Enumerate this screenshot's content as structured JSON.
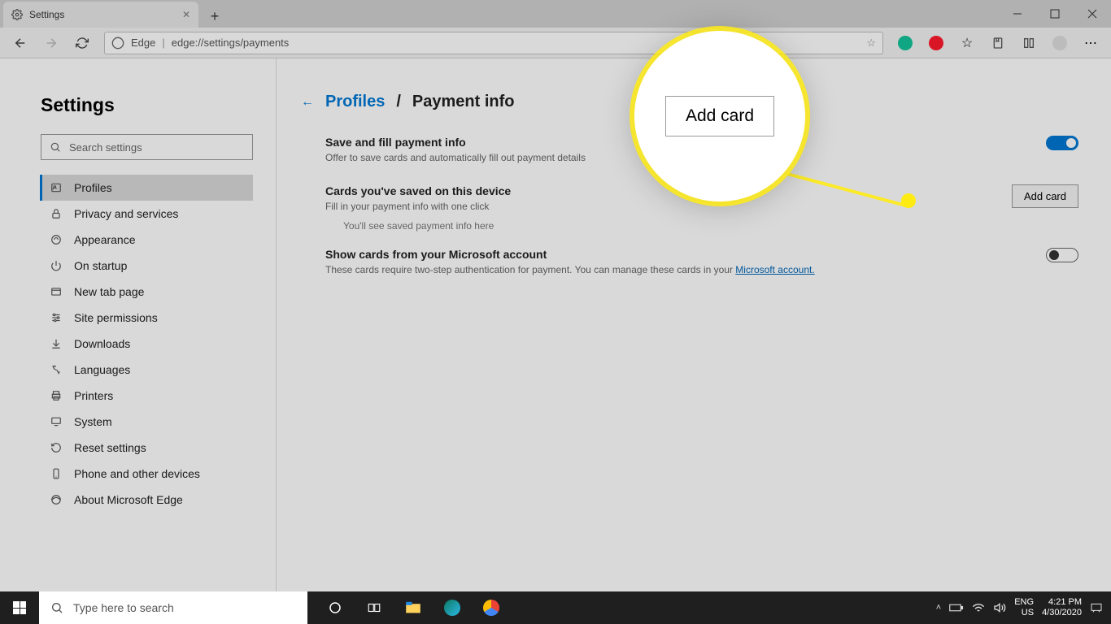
{
  "tab": {
    "title": "Settings"
  },
  "address": {
    "label": "Edge",
    "url": "edge://settings/payments"
  },
  "sidebar": {
    "heading": "Settings",
    "search_placeholder": "Search settings",
    "items": [
      {
        "label": "Profiles"
      },
      {
        "label": "Privacy and services"
      },
      {
        "label": "Appearance"
      },
      {
        "label": "On startup"
      },
      {
        "label": "New tab page"
      },
      {
        "label": "Site permissions"
      },
      {
        "label": "Downloads"
      },
      {
        "label": "Languages"
      },
      {
        "label": "Printers"
      },
      {
        "label": "System"
      },
      {
        "label": "Reset settings"
      },
      {
        "label": "Phone and other devices"
      },
      {
        "label": "About Microsoft Edge"
      }
    ]
  },
  "main": {
    "back_crumb": "Profiles",
    "crumb_sep": "/",
    "current": "Payment info",
    "section1": {
      "title": "Save and fill payment info",
      "desc": "Offer to save cards and automatically fill out payment details"
    },
    "section2": {
      "title": "Cards you've saved on this device",
      "desc": "Fill in your payment info with one click",
      "button": "Add card",
      "empty": "You'll see saved payment info here"
    },
    "section3": {
      "title": "Show cards from your Microsoft account",
      "desc_pre": "These cards require two-step authentication for payment. You can manage these cards in your ",
      "link": "Microsoft account.",
      "desc_post": ""
    }
  },
  "spotlight": {
    "button": "Add card"
  },
  "taskbar": {
    "search_placeholder": "Type here to search",
    "lang1": "ENG",
    "lang2": "US",
    "time": "4:21 PM",
    "date": "4/30/2020"
  }
}
